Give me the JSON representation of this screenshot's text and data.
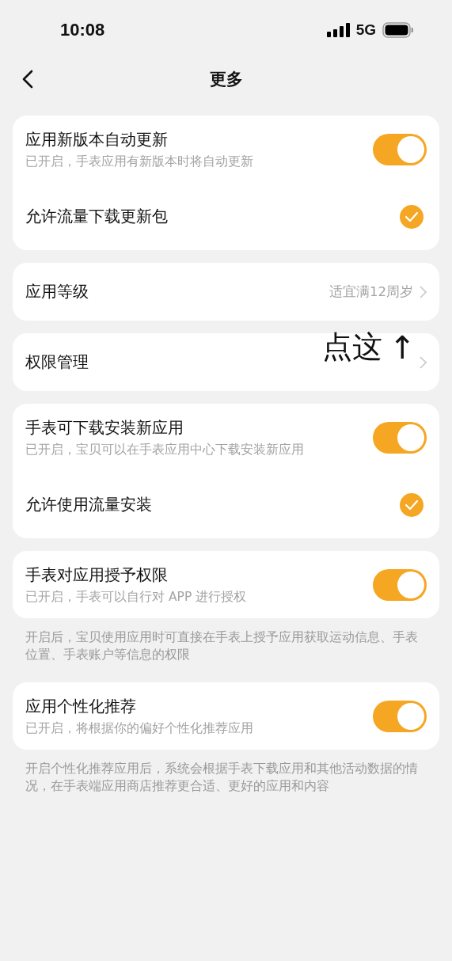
{
  "status_bar": {
    "time": "10:08",
    "network": "5G"
  },
  "nav": {
    "title": "更多"
  },
  "sections": [
    {
      "rows": [
        {
          "kind": "toggle",
          "title": "应用新版本自动更新",
          "subtitle": "已开启，手表应用有新版本时将自动更新",
          "on": true
        },
        {
          "kind": "check",
          "title": "允许流量下载更新包",
          "checked": true
        }
      ]
    },
    {
      "rows": [
        {
          "kind": "link",
          "title": "应用等级",
          "value": "适宜满12周岁"
        }
      ]
    },
    {
      "rows": [
        {
          "kind": "link",
          "title": "权限管理"
        }
      ],
      "annotation": {
        "text": "点这",
        "arrow": "↑"
      }
    },
    {
      "rows": [
        {
          "kind": "toggle",
          "title": "手表可下载安装新应用",
          "subtitle": "已开启，宝贝可以在手表应用中心下载安装新应用",
          "on": true
        },
        {
          "kind": "check",
          "title": "允许使用流量安装",
          "checked": true
        }
      ]
    },
    {
      "rows": [
        {
          "kind": "toggle",
          "title": "手表对应用授予权限",
          "subtitle": "已开启，手表可以自行对 APP 进行授权",
          "on": true
        }
      ],
      "footnote": "开启后，宝贝使用应用时可直接在手表上授予应用获取运动信息、手表位置、手表账户等信息的权限"
    },
    {
      "rows": [
        {
          "kind": "toggle",
          "title": "应用个性化推荐",
          "subtitle": "已开启，将根据你的偏好个性化推荐应用",
          "on": true
        }
      ],
      "footnote": "开启个性化推荐应用后，系统会根据手表下载应用和其他活动数据的情况，在手表端应用商店推荐更合适、更好的应用和内容"
    }
  ]
}
